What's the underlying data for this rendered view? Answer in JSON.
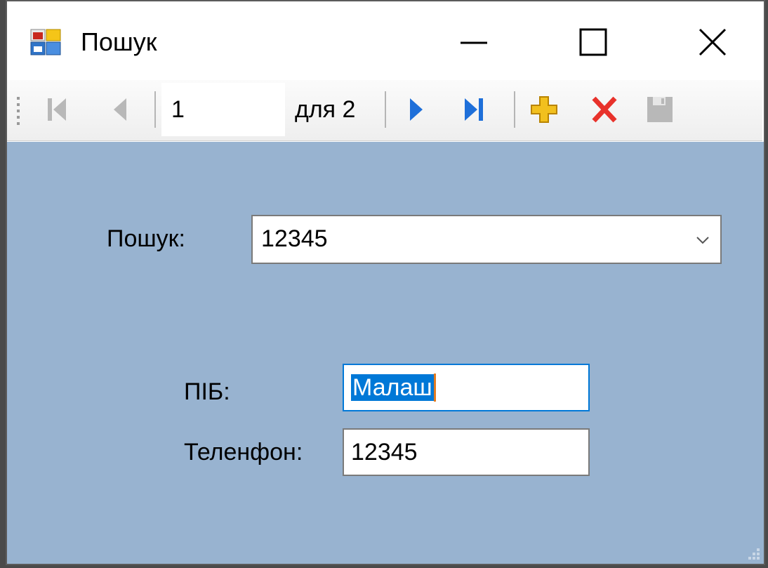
{
  "window": {
    "title": "Пошук",
    "icons": {
      "app": "app-window-icon",
      "minimize": "minimize-icon",
      "maximize": "maximize-icon",
      "close": "close-icon"
    }
  },
  "navigator": {
    "position_value": "1",
    "count_label": "для 2",
    "icons": [
      "move-first-icon",
      "move-previous-icon",
      "move-next-icon",
      "move-last-icon",
      "add-new-icon",
      "delete-icon",
      "save-icon"
    ],
    "colors": {
      "nav_active": "#1e6fd9",
      "nav_disabled": "#b8b8b8",
      "add": "#f2c01e",
      "delete": "#e8322b"
    }
  },
  "form": {
    "search_label": "Пошук:",
    "search_value": "12345",
    "pib_label": "ПІБ:",
    "pib_value": "Малаш",
    "phone_label": "Теленфон:",
    "phone_value": "12345",
    "background_color": "#98b3d0",
    "focus_color": "#0078d7"
  }
}
